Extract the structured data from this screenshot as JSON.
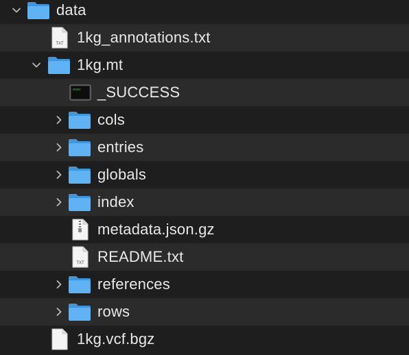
{
  "rows": [
    {
      "label": "data",
      "type": "folder",
      "expanded": true
    },
    {
      "label": "1kg_annotations.txt",
      "type": "txt-file",
      "icon_text": "TXT"
    },
    {
      "label": "1kg.mt",
      "type": "folder",
      "expanded": true
    },
    {
      "label": "_SUCCESS",
      "type": "executable",
      "icon_text": "exec"
    },
    {
      "label": "cols",
      "type": "folder",
      "expanded": false
    },
    {
      "label": "entries",
      "type": "folder",
      "expanded": false
    },
    {
      "label": "globals",
      "type": "folder",
      "expanded": false
    },
    {
      "label": "index",
      "type": "folder",
      "expanded": false
    },
    {
      "label": "metadata.json.gz",
      "type": "archive-file"
    },
    {
      "label": "README.txt",
      "type": "txt-file",
      "icon_text": "TXT"
    },
    {
      "label": "references",
      "type": "folder",
      "expanded": false
    },
    {
      "label": "rows",
      "type": "folder",
      "expanded": false
    },
    {
      "label": "1kg.vcf.bgz",
      "type": "blank-file"
    }
  ],
  "colors": {
    "background": "#1e1e1e",
    "stripe": "#2b2b2b",
    "folder": "#5fb3f5",
    "folder_tab": "#3f96de",
    "text": "#e8e8e8",
    "chevron": "#b8b8b8"
  }
}
